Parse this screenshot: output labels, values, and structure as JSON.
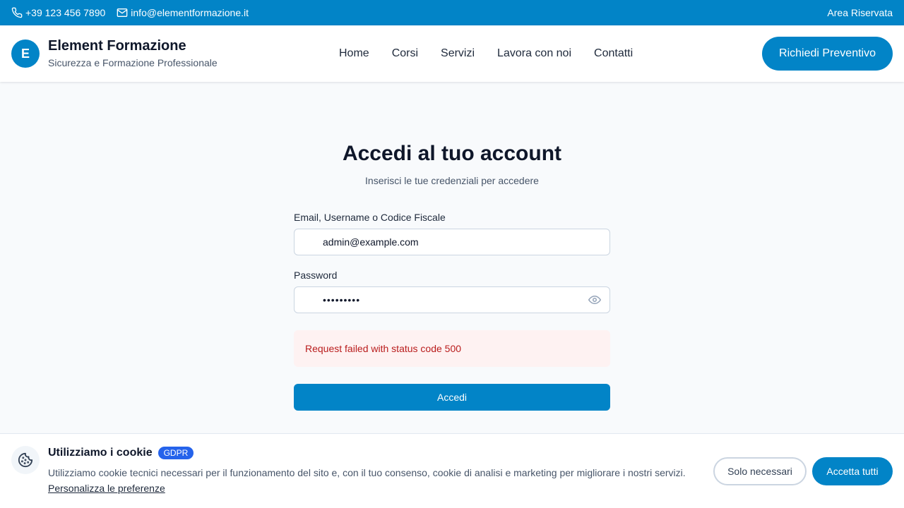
{
  "topbar": {
    "phone": "+39 123 456 7890",
    "email": "info@elementformazione.it",
    "reserved_area": "Area Riservata"
  },
  "header": {
    "logo_letter": "E",
    "brand_name": "Element Formazione",
    "tagline": "Sicurezza e Formazione Professionale",
    "nav": [
      {
        "label": "Home"
      },
      {
        "label": "Corsi"
      },
      {
        "label": "Servizi"
      },
      {
        "label": "Lavora con noi"
      },
      {
        "label": "Contatti"
      }
    ],
    "cta": "Richiedi Preventivo"
  },
  "login": {
    "title": "Accedi al tuo account",
    "subtitle": "Inserisci le tue credenziali per accedere",
    "username_label": "Email, Username o Codice Fiscale",
    "username_value": "admin@example.com",
    "password_label": "Password",
    "password_value": "•••••••••",
    "error": "Request failed with status code 500",
    "submit": "Accedi"
  },
  "cookie": {
    "title": "Utilizziamo i cookie",
    "badge": "GDPR",
    "text": "Utilizziamo cookie tecnici necessari per il funzionamento del sito e, con il tuo consenso, cookie di analisi e marketing per migliorare i nostri servizi.",
    "link": "Personalizza le preferenze",
    "necessary_button": "Solo necessari",
    "accept_button": "Accetta tutti"
  },
  "colors": {
    "primary": "#0284c7",
    "error_bg": "#fef2f2",
    "error_text": "#b91c1c",
    "badge": "#2563eb"
  },
  "icons": {
    "phone": "phone-icon",
    "email": "mail-icon",
    "password_toggle": "eye-icon",
    "cookie": "cookie-icon"
  }
}
